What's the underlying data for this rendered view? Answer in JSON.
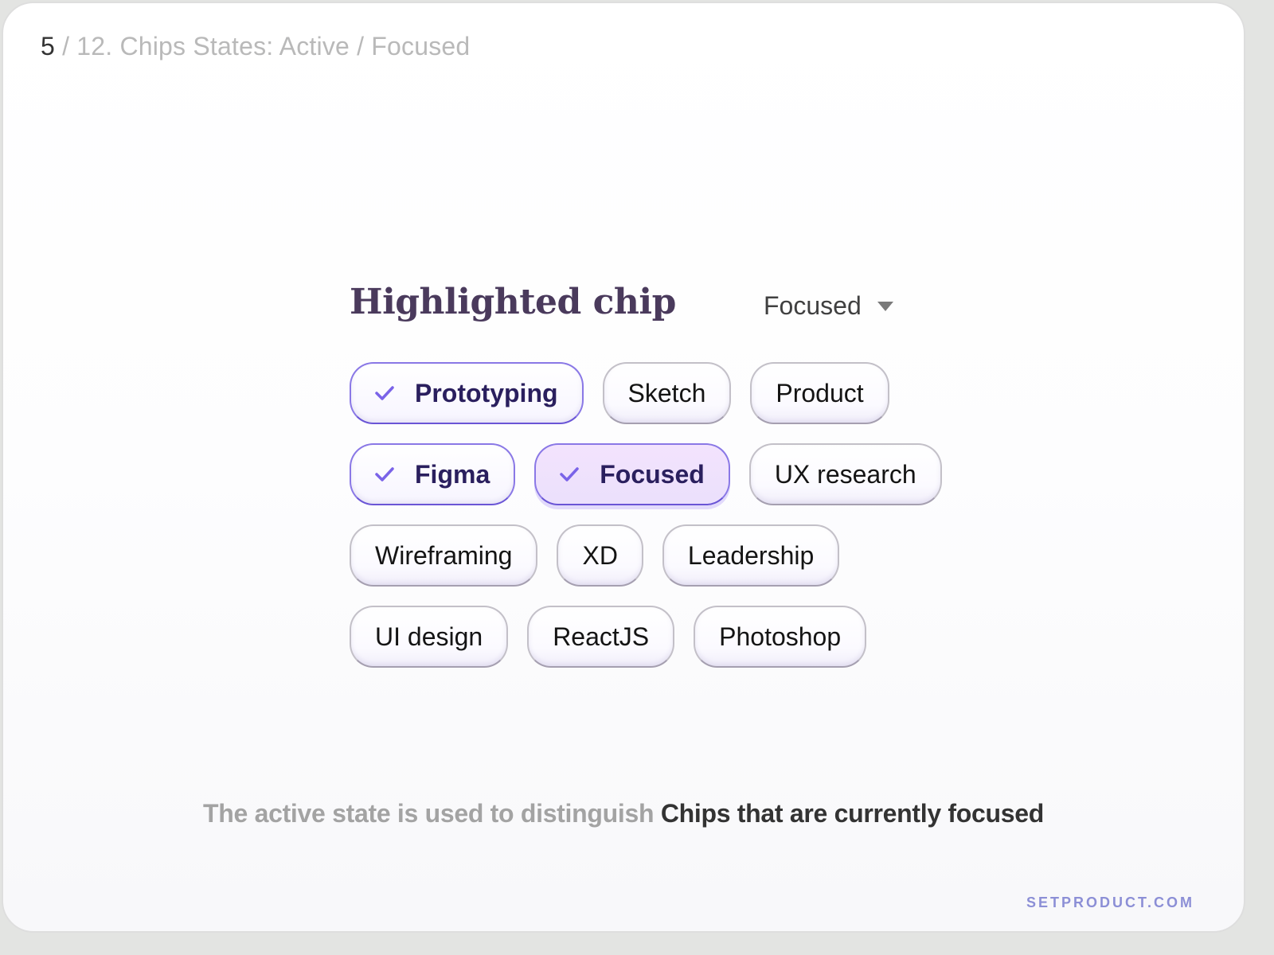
{
  "header": {
    "page_current": "5",
    "page_rest": " / 12. Chips States: Active / Focused"
  },
  "section": {
    "title": "Highlighted chip",
    "state_dropdown": {
      "selected": "Focused",
      "icon": "caret-down-icon"
    }
  },
  "chips": {
    "rows": [
      [
        {
          "label": "Prototyping",
          "state": "active",
          "icon": "check-icon"
        },
        {
          "label": "Sketch",
          "state": "default"
        },
        {
          "label": "Product",
          "state": "default"
        }
      ],
      [
        {
          "label": "Figma",
          "state": "active",
          "icon": "check-icon"
        },
        {
          "label": "Focused",
          "state": "focused",
          "icon": "check-icon"
        },
        {
          "label": "UX research",
          "state": "default"
        }
      ],
      [
        {
          "label": "Wireframing",
          "state": "default"
        },
        {
          "label": "XD",
          "state": "default"
        },
        {
          "label": "Leadership",
          "state": "default"
        }
      ],
      [
        {
          "label": "UI design",
          "state": "default"
        },
        {
          "label": "ReactJS",
          "state": "default"
        },
        {
          "label": "Photoshop",
          "state": "default"
        }
      ]
    ]
  },
  "caption": {
    "muted": "The active state is used to distinguish ",
    "strong": "Chips that are currently focused"
  },
  "footer": {
    "brand": "SETPRODUCT.COM"
  },
  "colors": {
    "accent": "#6a55d6",
    "check": "#7a63e8",
    "title": "#4a3a5c",
    "focused_fill": "#efe2fd",
    "brand": "#8c8fd6"
  }
}
